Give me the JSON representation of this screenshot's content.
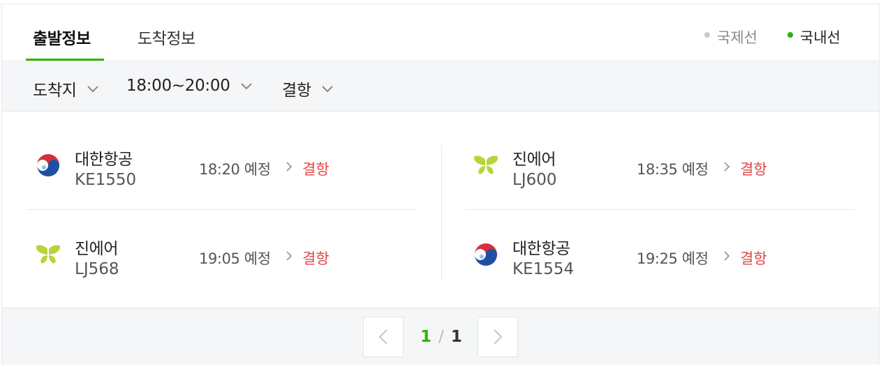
{
  "tabs": {
    "departure": "출발정보",
    "arrival": "도착정보"
  },
  "route_toggle": {
    "international": "국제선",
    "domestic": "국내선"
  },
  "filters": {
    "destination": "도착지",
    "time_range": "18:00~20:00",
    "status": "결항"
  },
  "flights": [
    {
      "airline": "대한항공",
      "flight_no": "KE1550",
      "time": "18:20 예정",
      "status": "결항",
      "logo": "korean-air-logo"
    },
    {
      "airline": "진에어",
      "flight_no": "LJ600",
      "time": "18:35 예정",
      "status": "결항",
      "logo": "jin-air-logo"
    },
    {
      "airline": "진에어",
      "flight_no": "LJ568",
      "time": "19:05 예정",
      "status": "결항",
      "logo": "jin-air-logo"
    },
    {
      "airline": "대한항공",
      "flight_no": "KE1554",
      "time": "19:25 예정",
      "status": "결항",
      "logo": "korean-air-logo"
    }
  ],
  "pagination": {
    "current": "1",
    "separator": "/",
    "total": "1"
  },
  "colors": {
    "accent": "#2db400",
    "cancelled": "#e24545",
    "inactive_dot": "#c9c9c9"
  }
}
